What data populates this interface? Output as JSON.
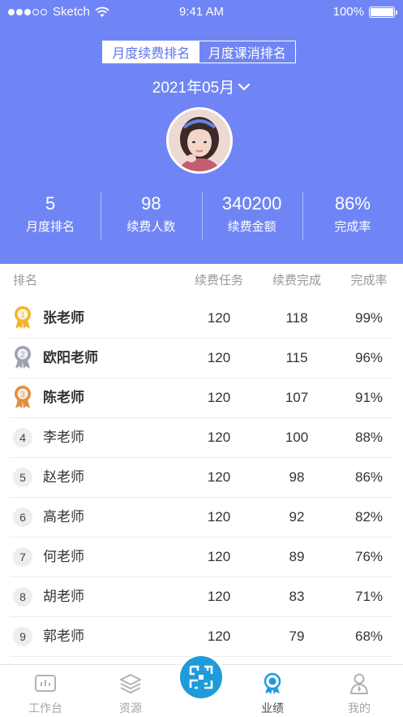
{
  "status": {
    "carrier": "Sketch",
    "time": "9:41 AM",
    "battery": "100%"
  },
  "segments": [
    {
      "label": "月度续费排名",
      "active": true
    },
    {
      "label": "月度课消排名",
      "active": false
    }
  ],
  "month": "2021年05月",
  "stats": [
    {
      "value": "5",
      "label": "月度排名"
    },
    {
      "value": "98",
      "label": "续费人数"
    },
    {
      "value": "340200",
      "label": "续费金额"
    },
    {
      "value": "86%",
      "label": "完成率"
    }
  ],
  "table": {
    "headers": {
      "rank": "排名",
      "task": "续费任务",
      "done": "续费完成",
      "rate": "完成率"
    },
    "rows": [
      {
        "rank": "1",
        "name": "张老师",
        "task": "120",
        "done": "118",
        "rate": "99%"
      },
      {
        "rank": "2",
        "name": "欧阳老师",
        "task": "120",
        "done": "115",
        "rate": "96%"
      },
      {
        "rank": "3",
        "name": "陈老师",
        "task": "120",
        "done": "107",
        "rate": "91%"
      },
      {
        "rank": "4",
        "name": "李老师",
        "task": "120",
        "done": "100",
        "rate": "88%"
      },
      {
        "rank": "5",
        "name": "赵老师",
        "task": "120",
        "done": "98",
        "rate": "86%"
      },
      {
        "rank": "6",
        "name": "高老师",
        "task": "120",
        "done": "92",
        "rate": "82%"
      },
      {
        "rank": "7",
        "name": "何老师",
        "task": "120",
        "done": "89",
        "rate": "76%"
      },
      {
        "rank": "8",
        "name": "胡老师",
        "task": "120",
        "done": "83",
        "rate": "71%"
      },
      {
        "rank": "9",
        "name": "郭老师",
        "task": "120",
        "done": "79",
        "rate": "68%"
      }
    ]
  },
  "tabs": [
    {
      "label": "工作台",
      "icon": "dashboard-icon"
    },
    {
      "label": "资源",
      "icon": "layers-icon"
    },
    {
      "label": "业绩",
      "icon": "award-icon",
      "active": true
    },
    {
      "label": "我的",
      "icon": "user-icon"
    }
  ],
  "colors": {
    "header": "#7085f5",
    "center_button": "#1f9bd9",
    "gold": "#f2b52a",
    "silver": "#9aa3ad",
    "bronze": "#e38d3c"
  }
}
